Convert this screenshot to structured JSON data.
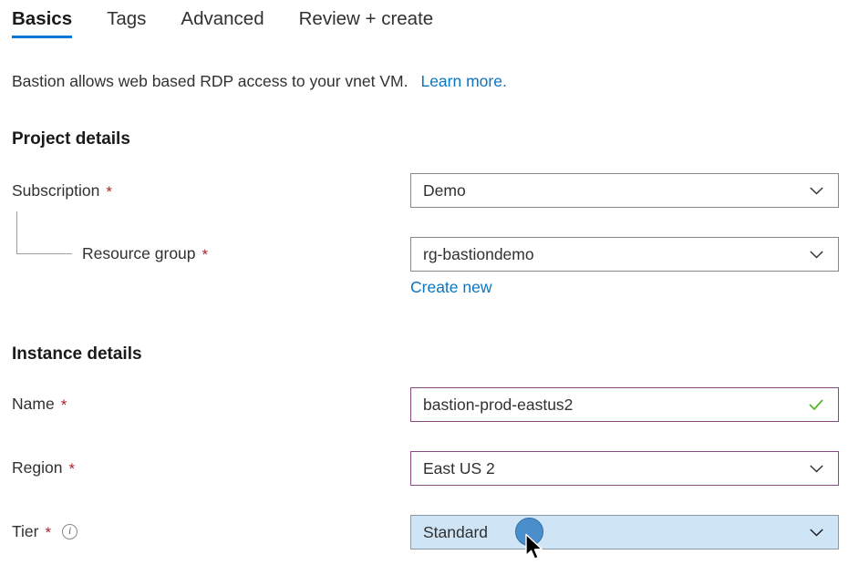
{
  "tabs": [
    {
      "label": "Basics",
      "active": true
    },
    {
      "label": "Tags",
      "active": false
    },
    {
      "label": "Advanced",
      "active": false
    },
    {
      "label": "Review + create",
      "active": false
    }
  ],
  "intro": {
    "text": "Bastion allows web based RDP access to your vnet VM.",
    "link_label": "Learn more."
  },
  "sections": {
    "project_details": {
      "heading": "Project details",
      "fields": {
        "subscription": {
          "label": "Subscription",
          "required": "*",
          "value": "Demo",
          "control": "dropdown"
        },
        "resource_group": {
          "label": "Resource group",
          "required": "*",
          "value": "rg-bastiondemo",
          "control": "dropdown",
          "secondary_link": "Create new"
        }
      }
    },
    "instance_details": {
      "heading": "Instance details",
      "fields": {
        "name": {
          "label": "Name",
          "required": "*",
          "value": "bastion-prod-eastus2",
          "control": "textbox",
          "state": "valid"
        },
        "region": {
          "label": "Region",
          "required": "*",
          "value": "East US 2",
          "control": "dropdown",
          "state": "valid"
        },
        "tier": {
          "label": "Tier",
          "required": "*",
          "value": "Standard",
          "control": "dropdown",
          "state": "highlighted",
          "info_glyph": "i"
        }
      }
    }
  },
  "colors": {
    "accent_blue": "#0078d4",
    "link_blue": "#0a75c2",
    "required_red": "#a4262c",
    "valid_purple": "#8a4a7f",
    "valid_green": "#5ab52a",
    "highlight_bg": "#cfe4f5",
    "cursor_dot": "#4a8ecb"
  }
}
